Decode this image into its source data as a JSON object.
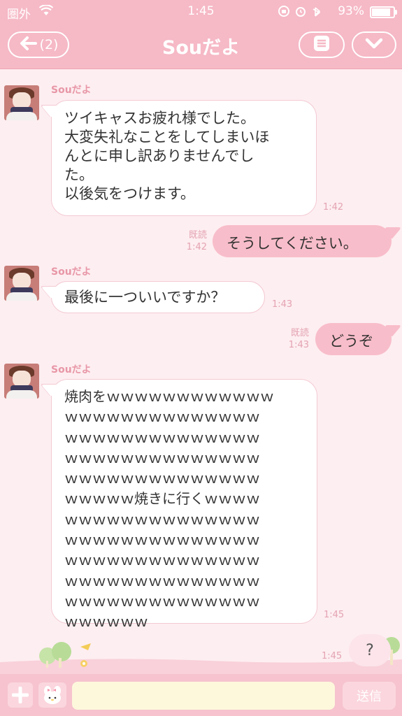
{
  "status": {
    "carrier": "圏外",
    "time": "1:45",
    "battery_pct": "93%",
    "battery_level": 0.93
  },
  "nav": {
    "back_label": "(2)",
    "title": "Souだよ"
  },
  "messages": [
    {
      "sender": "Souだよ",
      "text": "ツイキャスお疲れ様でした。\n大変失礼なことをしてしまいほ\nんとに申し訳ありませんでし\nた。\n以後気をつけます。",
      "time": "1:42"
    },
    {
      "read": "既読",
      "text": "そうしてください。",
      "time": "1:42"
    },
    {
      "sender": "Souだよ",
      "text": "最後に一ついいですか？",
      "time": "1:43"
    },
    {
      "read": "既読",
      "text": "どうぞ",
      "time": "1:43"
    },
    {
      "sender": "Souだよ",
      "text": "焼肉をｗｗｗｗｗｗｗｗｗｗｗｗ\nｗｗｗｗｗｗｗｗｗｗｗｗｗｗ\nｗｗｗｗｗｗｗｗｗｗｗｗｗｗ\nｗｗｗｗｗｗｗｗｗｗｗｗｗｗ\nｗｗｗｗｗｗｗｗｗｗｗｗｗｗ\nｗｗｗｗｗ焼きに行くｗｗｗｗ\nｗｗｗｗｗｗｗｗｗｗｗｗｗｗ\nｗｗｗｗｗｗｗｗｗｗｗｗｗｗ\nｗｗｗｗｗｗｗｗｗｗｗｗｗｗ\nｗｗｗｗｗｗｗｗｗｗｗｗｗｗ\nｗｗｗｗｗｗｗｗｗｗｗｗｗｗ\nｗｗｗｗｗｗ",
      "time": "1:45"
    },
    {
      "text": "?",
      "time": "1:45"
    }
  ],
  "input": {
    "placeholder": "",
    "send_label": "送信"
  },
  "colors": {
    "header": "#f6b9c6",
    "background": "#fdeef1",
    "outgoing": "#f8bdca"
  }
}
